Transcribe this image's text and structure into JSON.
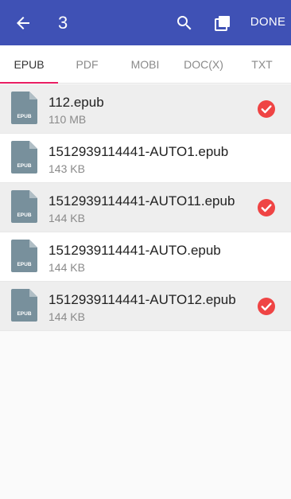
{
  "header": {
    "selected_count": "3",
    "done_label": "DONE",
    "icons": [
      "arrow-back-icon",
      "search-icon",
      "select-all-icon"
    ],
    "background": "#3f51b5"
  },
  "tabs": [
    {
      "label": "EPUB",
      "active": true
    },
    {
      "label": "PDF",
      "active": false
    },
    {
      "label": "MOBI",
      "active": false
    },
    {
      "label": "DOC(X)",
      "active": false
    },
    {
      "label": "TXT",
      "active": false
    }
  ],
  "tab_indicator_color": "#e91e63",
  "files": [
    {
      "name": "112.epub",
      "size": "110 MB",
      "type_label": "EPUB",
      "selected": true
    },
    {
      "name": "1512939114441-AUTO1.epub",
      "size": "143 KB",
      "type_label": "EPUB",
      "selected": false
    },
    {
      "name": "1512939114441-AUTO11.epub",
      "size": "144 KB",
      "type_label": "EPUB",
      "selected": true
    },
    {
      "name": "1512939114441-AUTO.epub",
      "size": "144 KB",
      "type_label": "EPUB",
      "selected": false
    },
    {
      "name": "1512939114441-AUTO12.epub",
      "size": "144 KB",
      "type_label": "EPUB",
      "selected": true
    }
  ],
  "check_color": "#ef4444",
  "file_icon_color": "#78909c"
}
